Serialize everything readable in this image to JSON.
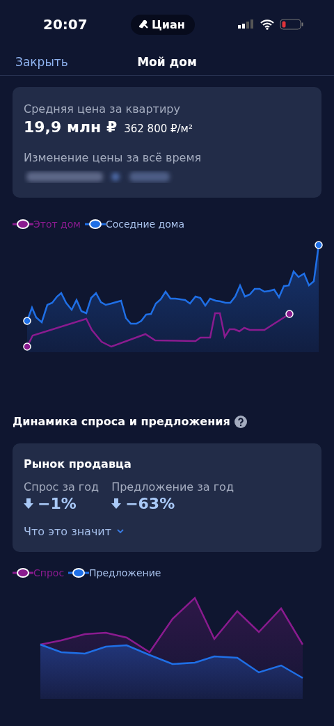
{
  "status_bar": {
    "time": "20:07",
    "app_pill": "Циан"
  },
  "nav": {
    "close": "Закрыть",
    "title": "Мой дом"
  },
  "price_card": {
    "label": "Средняя цена за квартиру",
    "price": "19,9 млн ₽",
    "per_meter": "362 800 ₽/м²",
    "change_label": "Изменение цены за всё время"
  },
  "price_chart": {
    "legend": [
      {
        "label": "Этот дом",
        "color": "#8a1b8f"
      },
      {
        "label": "Соседние дома",
        "color": "#1f6fe6"
      }
    ]
  },
  "section": {
    "title": "Динамика спроса и предложения"
  },
  "market_card": {
    "title": "Рынок продавца",
    "stats": [
      {
        "label": "Спрос за год",
        "value": "−1%"
      },
      {
        "label": "Предложение за год",
        "value": "−63%"
      }
    ],
    "more_link": "Что это значит"
  },
  "demand_chart": {
    "legend": [
      {
        "label": "Спрос",
        "color": "#8a1b8f"
      },
      {
        "label": "Предложение",
        "color": "#1f6fe6"
      }
    ]
  }
}
